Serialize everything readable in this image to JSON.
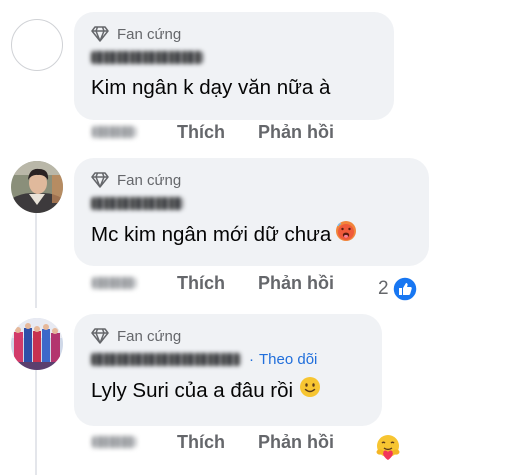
{
  "comments": [
    {
      "badge": "Fan cứng",
      "text": "Kim ngân k dạy văn nữa à",
      "like_label": "Thích",
      "reply_label": "Phản hồi"
    },
    {
      "badge": "Fan cứng",
      "text": "Mc kim ngân mới dữ chưa",
      "text_emoji": "hot-face-emoji",
      "like_label": "Thích",
      "reply_label": "Phản hồi",
      "reaction_count": "2",
      "reaction_icon": "like-icon"
    },
    {
      "badge": "Fan cứng",
      "follow_label": "Theo dõi",
      "dot": "·",
      "text": "Lyly Suri của a đâu rồi",
      "text_emoji": "smiling-face-emoji",
      "like_label": "Thích",
      "reply_label": "Phản hồi",
      "reaction_icon": "care-emoji"
    }
  ],
  "colors": {
    "bubble": "#f0f2f5",
    "secondary_text": "#65676b",
    "link": "#216fdb",
    "like_blue": "#1877f2"
  }
}
